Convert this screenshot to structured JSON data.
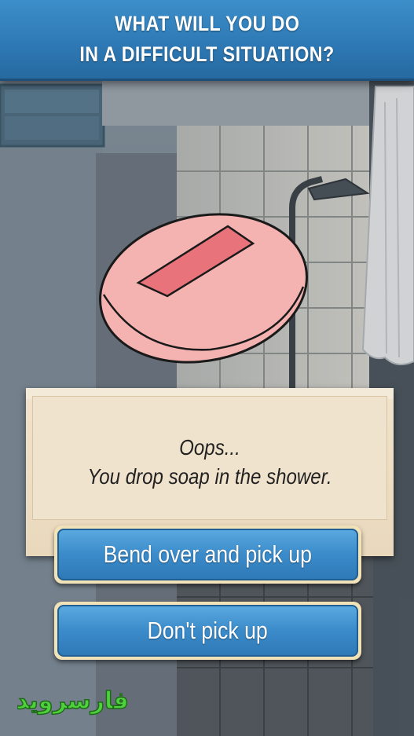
{
  "header": {
    "line1": "WHAT WILL YOU DO",
    "line2": "IN A DIFFICULT SITUATION?"
  },
  "scene": {
    "description_icon": "soap-bar-icon",
    "soap_color": "#f4b3b0",
    "label_color": "#e8737a"
  },
  "dialog": {
    "line1": "Oops...",
    "line2": "You drop soap in the shower."
  },
  "choices": [
    {
      "label": "Bend over and pick up"
    },
    {
      "label": "Don't pick up"
    }
  ],
  "watermark": {
    "text": "فارسروید"
  },
  "colors": {
    "accent": "#2d78b4",
    "button": "#3b8bca",
    "note": "#f0e3cd"
  }
}
